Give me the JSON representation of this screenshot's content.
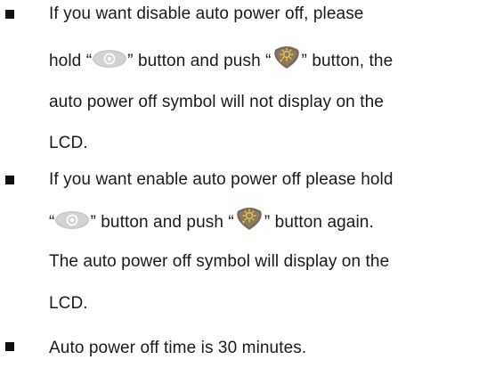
{
  "bullets": [
    {
      "lines": [
        {
          "type": "text",
          "text": "If you want disable auto power off, please"
        },
        {
          "type": "icons",
          "a": "hold “",
          "b": "” button and push “",
          "c": "” button, the"
        },
        {
          "type": "text",
          "text": "auto power off symbol will not display on the"
        },
        {
          "type": "text",
          "text": "LCD."
        }
      ]
    },
    {
      "lines": [
        {
          "type": "text",
          "text": "If you want enable auto power off please hold"
        },
        {
          "type": "icons",
          "a": "“",
          "b": "” button and push “",
          "c": "” button again."
        },
        {
          "type": "text",
          "text": "The auto power off symbol will display on the"
        },
        {
          "type": "text",
          "text": "LCD."
        }
      ]
    },
    {
      "lines": [
        {
          "type": "text",
          "text": "Auto power off time is 30 minutes."
        }
      ]
    }
  ],
  "icons": {
    "power_button": "power-button-icon",
    "backlight_button": "backlight-button-icon"
  },
  "colors": {
    "text": "#1a1a1a",
    "bullet": "#111111",
    "power_button_fill": "#c9c9c9",
    "power_button_symbol": "#ffffff",
    "backlight_button_fill": "#7a6b59",
    "backlight_button_symbol": "#f4d23c"
  }
}
